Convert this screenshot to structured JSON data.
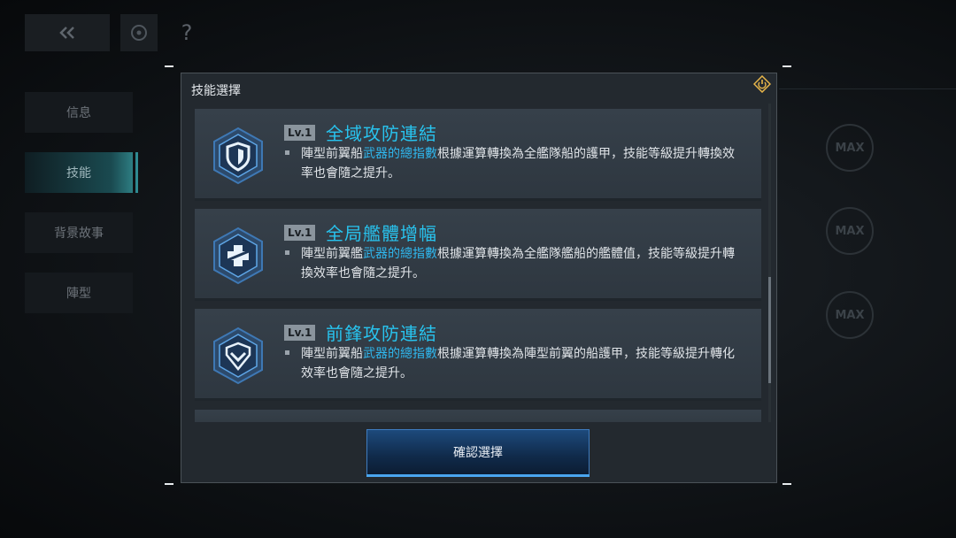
{
  "topbar": {
    "help_label": "?"
  },
  "side_tabs": [
    {
      "label": "信息",
      "active": false
    },
    {
      "label": "技能",
      "active": true
    },
    {
      "label": "背景故事",
      "active": false
    },
    {
      "label": "陣型",
      "active": false
    }
  ],
  "max_badges": [
    "MAX",
    "MAX",
    "MAX"
  ],
  "dialog": {
    "title": "技能選擇",
    "skills": [
      {
        "level": "Lv.1",
        "name": "全域攻防連結",
        "icon": "shield-skill-icon",
        "desc_pre": "陣型前翼船",
        "desc_hl": "武器的總指數",
        "desc_post": "根據運算轉換為全艦隊船的護甲，技能等級提升轉換效率也會隨之提升。"
      },
      {
        "level": "Lv.1",
        "name": "全局艦體增幅",
        "icon": "plus-skill-icon",
        "desc_pre": "陣型前翼艦",
        "desc_hl": "武器的總指數",
        "desc_post": "根據運算轉換為全艦隊艦船的艦體值，技能等級提升轉換效率也會隨之提升。"
      },
      {
        "level": "Lv.1",
        "name": "前鋒攻防連結",
        "icon": "chevron-shield-skill-icon",
        "desc_pre": "陣型前翼船",
        "desc_hl": "武器的總指數",
        "desc_post": "根據運算轉換為陣型前翼的船護甲，技能等級提升轉化效率也會隨之提升。"
      }
    ],
    "confirm_label": "確認選擇"
  },
  "colors": {
    "accent_cyan": "#28c3ee",
    "highlight_blue": "#2fb8ef",
    "button_blue": "#1d4a7c"
  }
}
